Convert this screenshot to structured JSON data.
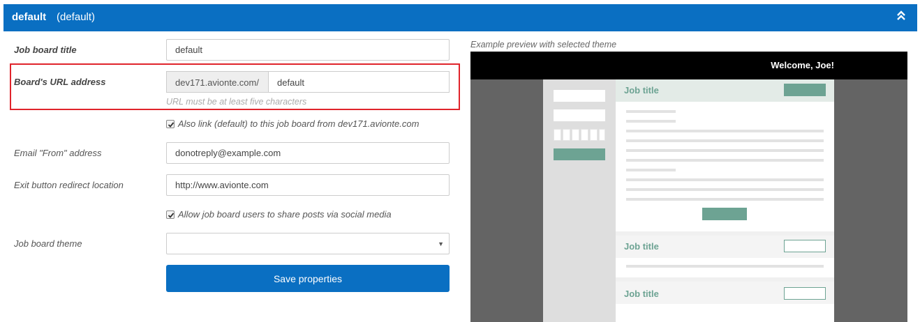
{
  "header": {
    "title": "default",
    "subtitle": "(default)"
  },
  "form": {
    "job_board_title": {
      "label": "Job board title",
      "value": "default"
    },
    "url": {
      "label": "Board's URL address",
      "prefix": "dev171.avionte.com/",
      "value": "default",
      "hint": "URL must be at least five characters"
    },
    "also_link": {
      "label": "Also link (default) to this job board from dev171.avionte.com",
      "checked": true
    },
    "email_from": {
      "label": "Email \"From\" address",
      "value": "donotreply@example.com"
    },
    "exit_redirect": {
      "label": "Exit button redirect location",
      "value": "http://www.avionte.com"
    },
    "allow_share": {
      "label": "Allow job board users to share posts via social media",
      "checked": true
    },
    "theme": {
      "label": "Job board theme",
      "value": ""
    },
    "save_label": "Save properties"
  },
  "preview": {
    "caption": "Example preview with selected theme",
    "welcome": "Welcome, Joe!",
    "job_titles": [
      "Job title",
      "Job title",
      "Job title"
    ],
    "colors": {
      "accent": "#6da393",
      "header_bg": "#000000",
      "page_bg": "#646464"
    }
  },
  "colors": {
    "primary": "#0a6fc2",
    "highlight": "#e0242b"
  }
}
